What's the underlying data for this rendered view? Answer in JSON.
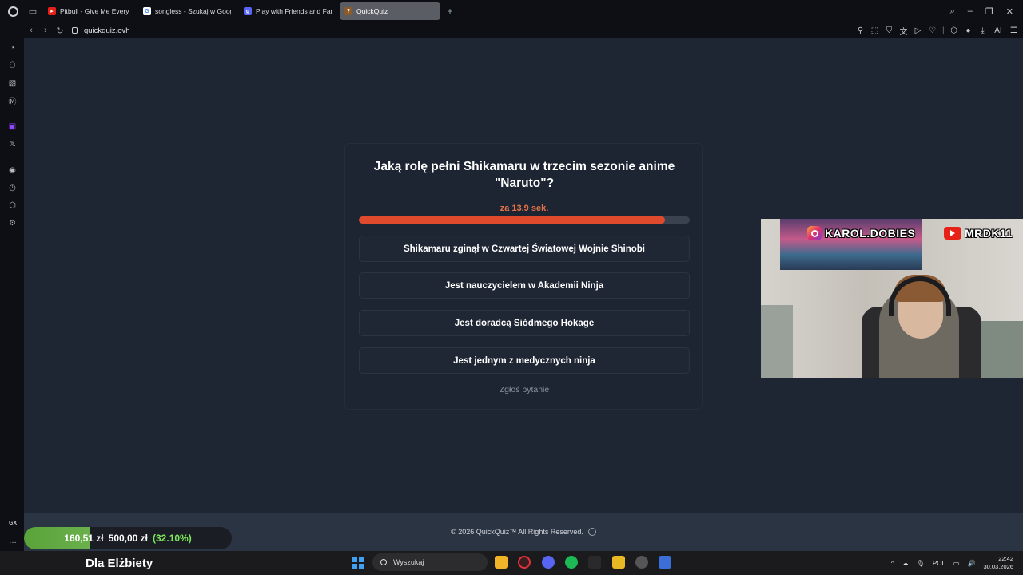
{
  "browser": {
    "tabs": [
      {
        "title": "Pitbull - Give Me Every",
        "color": "#e62117",
        "active": false
      },
      {
        "title": "songless - Szukaj w Goog",
        "color": "#4285f4",
        "active": false
      },
      {
        "title": "Play with Friends and Fam",
        "color": "#5865f2",
        "active": false
      },
      {
        "title": "QuickQuiz",
        "color": "#8b5a2b",
        "active": true
      }
    ],
    "url": "quickquiz.ovh"
  },
  "quiz": {
    "question": "Jaką rolę pełni Shikamaru w trzecim sezonie anime \"Naruto\"?",
    "timer": "za 13,9 sek.",
    "time_remaining_fraction": 0.925,
    "answers": [
      "Shikamaru zginął w Czwartej Światowej Wojnie Shinobi",
      "Jest nauczycielem w Akademii Ninja",
      "Jest doradcą Siódmego Hokage",
      "Jest jednym z medycznych ninja"
    ],
    "report": "Zgłoś pytanie"
  },
  "footer": {
    "text": "© 2026  QuickQuiz™ All Rights Reserved."
  },
  "stream": {
    "instagram": "KAROL.DOBIES",
    "youtube": "MRDK11",
    "donation_current": "160,51 zł",
    "donation_goal": "500,00 zł",
    "donation_percent": "(32.10%)",
    "donation_fraction": 0.321,
    "donation_label": "Dla Elżbiety"
  },
  "sidebar": {
    "gx_label": "GX"
  },
  "taskbar": {
    "search_placeholder": "Wyszukaj",
    "language": "POL",
    "time": "22:42",
    "date": "30.03.2026"
  }
}
